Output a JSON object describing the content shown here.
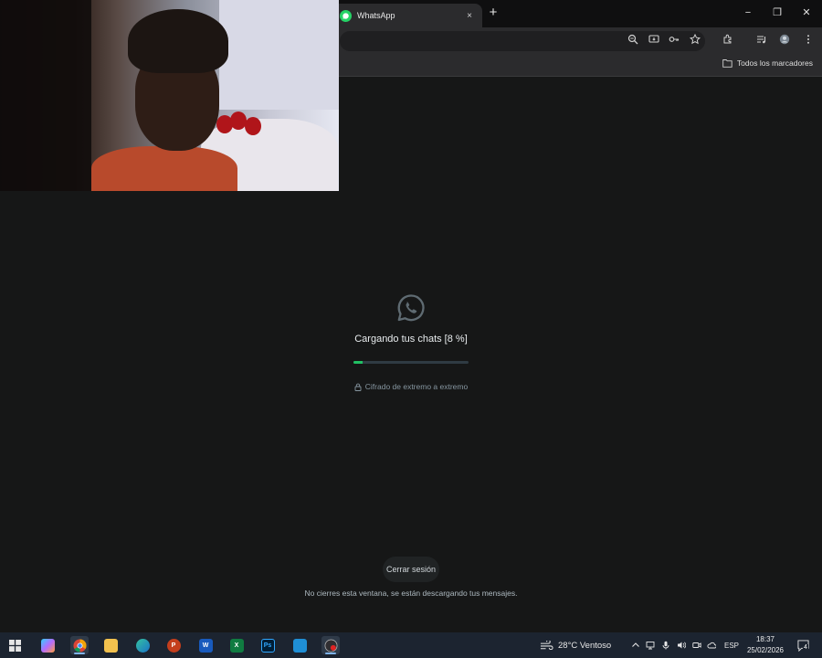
{
  "browser": {
    "tab_title": "WhatsApp",
    "tab_close_glyph": "×",
    "new_tab_glyph": "+",
    "window_controls": {
      "minimize": "−",
      "restore": "❐",
      "close": "✕"
    },
    "bookmarks_folder_label": "Todos los marcadores"
  },
  "whatsapp_loading": {
    "status_text": "Cargando tus chats [8 %]",
    "progress_fraction": 0.08,
    "encryption_label": "Cifrado de extremo a extremo",
    "logout_button": "Cerrar sesión",
    "notice": "No cierres esta ventana, se están descargando tus mensajes."
  },
  "taskbar": {
    "apps": [
      "windows-start",
      "copilot",
      "chrome",
      "file-explorer",
      "edge",
      "powerpoint",
      "word",
      "excel",
      "photoshop",
      "store",
      "obs"
    ],
    "active_app": "chrome",
    "weather": "28°C  Ventoso",
    "language": "ESP",
    "time": "18:37",
    "date": "25/02/2026",
    "notification_count": "4"
  },
  "colors": {
    "accent": "#21c063",
    "background": "#161717",
    "taskbar": "#1c2430"
  }
}
